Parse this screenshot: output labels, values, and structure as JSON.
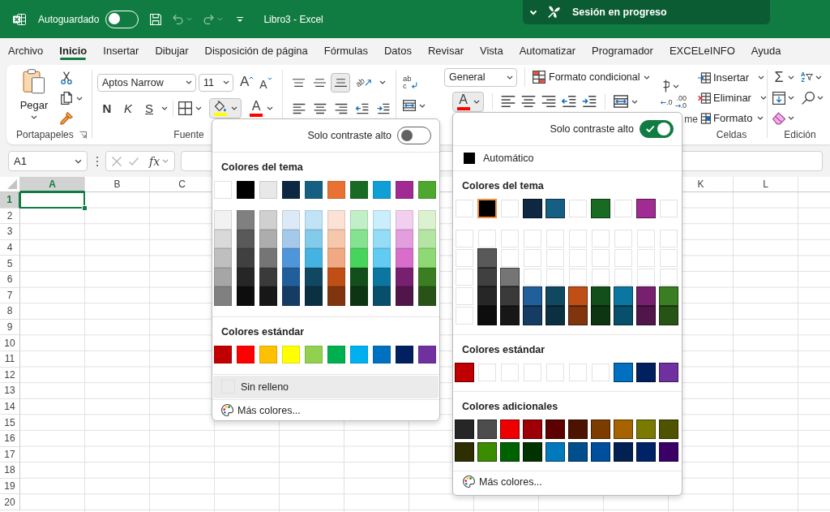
{
  "title_bar": {
    "autosave": {
      "label": "Autoguardado",
      "on": false
    },
    "document_title": "Libro3 - Excel",
    "session": {
      "label": "Sesión en progreso"
    }
  },
  "tabs": [
    {
      "label": "Archivo",
      "selected": false
    },
    {
      "label": "Inicio",
      "selected": true
    },
    {
      "label": "Insertar",
      "selected": false
    },
    {
      "label": "Dibujar",
      "selected": false
    },
    {
      "label": "Disposición de página",
      "selected": false
    },
    {
      "label": "Fórmulas",
      "selected": false
    },
    {
      "label": "Datos",
      "selected": false
    },
    {
      "label": "Revisar",
      "selected": false
    },
    {
      "label": "Vista",
      "selected": false
    },
    {
      "label": "Automatizar",
      "selected": false
    },
    {
      "label": "Programador",
      "selected": false
    },
    {
      "label": "EXCELeINFO",
      "selected": false
    },
    {
      "label": "Ayuda",
      "selected": false
    }
  ],
  "ribbon": {
    "clipboard": {
      "paste_label": "Pegar",
      "group_label": "Portapapeles"
    },
    "font": {
      "font_name": "Aptos Narrow",
      "font_size": "11",
      "grow_font": "A",
      "shrink_font": "A",
      "bold": "N",
      "italic": "K",
      "underline": "S",
      "fill_color": {
        "open": true,
        "color": "#ffff00"
      },
      "font_color": {
        "glyph": "A",
        "open": false,
        "color": "#ff0000"
      },
      "group_label": "Fuente"
    },
    "alignment": {
      "vertical": [
        {
          "selected": false
        },
        {
          "selected": false
        },
        {
          "selected": true
        }
      ],
      "orientation": "ab",
      "wrap_text": [
        "ab",
        "c"
      ]
    },
    "number": {
      "format": "General",
      "decrease_decimal": ".0",
      "increase_decimal": [
        ".00",
        ".0"
      ],
      "group_label": "me"
    },
    "styles": {
      "conditional_formatting": "Formato condicional"
    },
    "font_color_dropdown": {
      "glyph": "A",
      "open": true,
      "color": "#ff0000"
    },
    "cells": {
      "items": [
        "Insertar",
        "Eliminar",
        "Formato"
      ],
      "group_label": "Celdas"
    },
    "editing": {
      "autosum": "Σ",
      "sort_glyphs": [
        "A",
        "Z"
      ],
      "group_label": "Edición"
    }
  },
  "formula_bar": {
    "name_box": "A1",
    "function_label": "fx"
  },
  "grid": {
    "columns_before": [
      {
        "label": "A",
        "selected": true
      },
      {
        "label": "B",
        "selected": false
      },
      {
        "label": "C",
        "selected": false
      }
    ],
    "columns_after": [
      {
        "label": "K",
        "selected": false
      },
      {
        "label": "L",
        "selected": false
      }
    ],
    "rows": [
      {
        "label": "1",
        "selected": true
      },
      {
        "label": "2",
        "selected": false
      },
      {
        "label": "3",
        "selected": false
      },
      {
        "label": "4",
        "selected": false
      },
      {
        "label": "5",
        "selected": false
      },
      {
        "label": "6",
        "selected": false
      },
      {
        "label": "7",
        "selected": false
      },
      {
        "label": "8",
        "selected": false
      },
      {
        "label": "9",
        "selected": false
      },
      {
        "label": "10",
        "selected": false
      },
      {
        "label": "11",
        "selected": false
      },
      {
        "label": "12",
        "selected": false
      },
      {
        "label": "13",
        "selected": false
      },
      {
        "label": "14",
        "selected": false
      },
      {
        "label": "15",
        "selected": false
      },
      {
        "label": "16",
        "selected": false
      },
      {
        "label": "17",
        "selected": false
      },
      {
        "label": "18",
        "selected": false
      },
      {
        "label": "19",
        "selected": false
      },
      {
        "label": "20",
        "selected": false
      }
    ]
  },
  "fill_color_menu": {
    "high_contrast": {
      "label": "Solo contraste alto",
      "on": false
    },
    "sections": [
      {
        "kind": "theme",
        "title": "Colores del tema",
        "top": [
          {
            "kind": "swatch",
            "color": "#ffffff",
            "selected": false
          },
          {
            "kind": "swatch",
            "color": "#000000",
            "selected": false
          },
          {
            "kind": "swatch",
            "color": "#e8e8e8",
            "selected": false
          },
          {
            "kind": "swatch",
            "color": "#0e2841",
            "selected": false
          },
          {
            "kind": "swatch",
            "color": "#156082",
            "selected": false
          },
          {
            "kind": "swatch",
            "color": "#e97132",
            "selected": false
          },
          {
            "kind": "swatch",
            "color": "#196b24",
            "selected": false
          },
          {
            "kind": "swatch",
            "color": "#0f9ed5",
            "selected": false
          },
          {
            "kind": "swatch",
            "color": "#a02b93",
            "selected": false
          },
          {
            "kind": "swatch",
            "color": "#4ea72e",
            "selected": false
          }
        ],
        "shades": [
          [
            {
              "kind": "swatch",
              "color": "#f2f2f2",
              "selected": false
            },
            {
              "kind": "swatch",
              "color": "#808080",
              "selected": false
            },
            {
              "kind": "swatch",
              "color": "#d0d0d0",
              "selected": false
            },
            {
              "kind": "swatch",
              "color": "#dceaf7",
              "selected": false
            },
            {
              "kind": "swatch",
              "color": "#c0e4f5",
              "selected": false
            },
            {
              "kind": "swatch",
              "color": "#fbe2d5",
              "selected": false
            },
            {
              "kind": "swatch",
              "color": "#c1f0c8",
              "selected": false
            },
            {
              "kind": "swatch",
              "color": "#caeefb",
              "selected": false
            },
            {
              "kind": "swatch",
              "color": "#f2ceef",
              "selected": false
            },
            {
              "kind": "swatch",
              "color": "#daf2d0",
              "selected": false
            }
          ],
          [
            {
              "kind": "swatch",
              "color": "#d9d9d9",
              "selected": false
            },
            {
              "kind": "swatch",
              "color": "#595959",
              "selected": false
            },
            {
              "kind": "swatch",
              "color": "#adadad",
              "selected": false
            },
            {
              "kind": "swatch",
              "color": "#a5c9eb",
              "selected": false
            },
            {
              "kind": "swatch",
              "color": "#83cbeb",
              "selected": false
            },
            {
              "kind": "swatch",
              "color": "#f7c7ac",
              "selected": false
            },
            {
              "kind": "swatch",
              "color": "#84e291",
              "selected": false
            },
            {
              "kind": "swatch",
              "color": "#95dcf7",
              "selected": false
            },
            {
              "kind": "swatch",
              "color": "#e59edd",
              "selected": false
            },
            {
              "kind": "swatch",
              "color": "#b4e5a2",
              "selected": false
            }
          ],
          [
            {
              "kind": "swatch",
              "color": "#bfbfbf",
              "selected": false
            },
            {
              "kind": "swatch",
              "color": "#404040",
              "selected": false
            },
            {
              "kind": "swatch",
              "color": "#757575",
              "selected": false
            },
            {
              "kind": "swatch",
              "color": "#4e95d9",
              "selected": false
            },
            {
              "kind": "swatch",
              "color": "#44b3e1",
              "selected": false
            },
            {
              "kind": "swatch",
              "color": "#f1a983",
              "selected": false
            },
            {
              "kind": "swatch",
              "color": "#47d45a",
              "selected": false
            },
            {
              "kind": "swatch",
              "color": "#61cbf3",
              "selected": false
            },
            {
              "kind": "swatch",
              "color": "#d86dcb",
              "selected": false
            },
            {
              "kind": "swatch",
              "color": "#8ed973",
              "selected": false
            }
          ],
          [
            {
              "kind": "swatch",
              "color": "#a6a6a6",
              "selected": false
            },
            {
              "kind": "swatch",
              "color": "#262626",
              "selected": false
            },
            {
              "kind": "swatch",
              "color": "#3a3a3a",
              "selected": false
            },
            {
              "kind": "swatch",
              "color": "#215f9a",
              "selected": false
            },
            {
              "kind": "swatch",
              "color": "#104862",
              "selected": false
            },
            {
              "kind": "swatch",
              "color": "#c04f15",
              "selected": false
            },
            {
              "kind": "swatch",
              "color": "#124f1a",
              "selected": false
            },
            {
              "kind": "swatch",
              "color": "#0b76a0",
              "selected": false
            },
            {
              "kind": "swatch",
              "color": "#782070",
              "selected": false
            },
            {
              "kind": "swatch",
              "color": "#3a7d22",
              "selected": false
            }
          ],
          [
            {
              "kind": "swatch",
              "color": "#808080",
              "selected": false
            },
            {
              "kind": "swatch",
              "color": "#0d0d0d",
              "selected": false
            },
            {
              "kind": "swatch",
              "color": "#171717",
              "selected": false
            },
            {
              "kind": "swatch",
              "color": "#153d64",
              "selected": false
            },
            {
              "kind": "swatch",
              "color": "#0b3041",
              "selected": false
            },
            {
              "kind": "swatch",
              "color": "#80350e",
              "selected": false
            },
            {
              "kind": "swatch",
              "color": "#0d3512",
              "selected": false
            },
            {
              "kind": "swatch",
              "color": "#074f6a",
              "selected": false
            },
            {
              "kind": "swatch",
              "color": "#501549",
              "selected": false
            },
            {
              "kind": "swatch",
              "color": "#275317",
              "selected": false
            }
          ]
        ]
      },
      {
        "kind": "rows",
        "title": "Colores estándar",
        "rows": [
          [
            {
              "kind": "swatch",
              "color": "#c00000",
              "selected": false
            },
            {
              "kind": "swatch",
              "color": "#ff0000",
              "selected": false
            },
            {
              "kind": "swatch",
              "color": "#ffc000",
              "selected": false
            },
            {
              "kind": "swatch",
              "color": "#ffff00",
              "selected": false
            },
            {
              "kind": "swatch",
              "color": "#92d050",
              "selected": false
            },
            {
              "kind": "swatch",
              "color": "#00b050",
              "selected": false
            },
            {
              "kind": "swatch",
              "color": "#00b0f0",
              "selected": false
            },
            {
              "kind": "swatch",
              "color": "#0070c0",
              "selected": false
            },
            {
              "kind": "swatch",
              "color": "#002060",
              "selected": false
            },
            {
              "kind": "swatch",
              "color": "#7030a0",
              "selected": false
            }
          ]
        ]
      }
    ],
    "items": [
      {
        "kind": "none",
        "label": "Sin relleno",
        "highlighted": true
      },
      {
        "kind": "more",
        "label": "Más colores...",
        "highlighted": false
      }
    ]
  },
  "font_color_menu": {
    "high_contrast": {
      "label": "Solo contraste alto",
      "on": true
    },
    "items_top": [
      {
        "kind": "auto",
        "label": "Automático",
        "color": "#000000",
        "highlighted": false
      }
    ],
    "sections": [
      {
        "kind": "theme",
        "title": "Colores del tema",
        "top": [
          {
            "kind": "blank",
            "selected": false
          },
          {
            "kind": "swatch",
            "color": "#000000",
            "selected": true
          },
          {
            "kind": "blank",
            "selected": false
          },
          {
            "kind": "swatch",
            "color": "#0e2841",
            "selected": false
          },
          {
            "kind": "swatch",
            "color": "#156082",
            "selected": false
          },
          {
            "kind": "blank",
            "selected": false
          },
          {
            "kind": "swatch",
            "color": "#196b24",
            "selected": false
          },
          {
            "kind": "blank",
            "selected": false
          },
          {
            "kind": "swatch",
            "color": "#a02b93",
            "selected": false
          },
          {
            "kind": "blank",
            "selected": false
          }
        ],
        "shades": [
          [
            {
              "kind": "blank",
              "selected": false
            },
            {
              "kind": "blank",
              "selected": false
            },
            {
              "kind": "blank",
              "selected": false
            },
            {
              "kind": "blank",
              "selected": false
            },
            {
              "kind": "blank",
              "selected": false
            },
            {
              "kind": "blank",
              "selected": false
            },
            {
              "kind": "blank",
              "selected": false
            },
            {
              "kind": "blank",
              "selected": false
            },
            {
              "kind": "blank",
              "selected": false
            },
            {
              "kind": "blank",
              "selected": false
            }
          ],
          [
            {
              "kind": "blank",
              "selected": false
            },
            {
              "kind": "swatch",
              "color": "#595959",
              "selected": false
            },
            {
              "kind": "blank",
              "selected": false
            },
            {
              "kind": "blank",
              "selected": false
            },
            {
              "kind": "blank",
              "selected": false
            },
            {
              "kind": "blank",
              "selected": false
            },
            {
              "kind": "blank",
              "selected": false
            },
            {
              "kind": "blank",
              "selected": false
            },
            {
              "kind": "blank",
              "selected": false
            },
            {
              "kind": "blank",
              "selected": false
            }
          ],
          [
            {
              "kind": "blank",
              "selected": false
            },
            {
              "kind": "swatch",
              "color": "#404040",
              "selected": false
            },
            {
              "kind": "swatch",
              "color": "#757575",
              "selected": false
            },
            {
              "kind": "blank",
              "selected": false
            },
            {
              "kind": "blank",
              "selected": false
            },
            {
              "kind": "blank",
              "selected": false
            },
            {
              "kind": "blank",
              "selected": false
            },
            {
              "kind": "blank",
              "selected": false
            },
            {
              "kind": "blank",
              "selected": false
            },
            {
              "kind": "blank",
              "selected": false
            }
          ],
          [
            {
              "kind": "blank",
              "selected": false
            },
            {
              "kind": "swatch",
              "color": "#262626",
              "selected": false
            },
            {
              "kind": "swatch",
              "color": "#3a3a3a",
              "selected": false
            },
            {
              "kind": "swatch",
              "color": "#215f9a",
              "selected": false
            },
            {
              "kind": "swatch",
              "color": "#104862",
              "selected": false
            },
            {
              "kind": "swatch",
              "color": "#c04f15",
              "selected": false
            },
            {
              "kind": "swatch",
              "color": "#124f1a",
              "selected": false
            },
            {
              "kind": "swatch",
              "color": "#0b76a0",
              "selected": false
            },
            {
              "kind": "swatch",
              "color": "#782070",
              "selected": false
            },
            {
              "kind": "swatch",
              "color": "#3a7d22",
              "selected": false
            }
          ],
          [
            {
              "kind": "blank",
              "selected": false
            },
            {
              "kind": "swatch",
              "color": "#0d0d0d",
              "selected": false
            },
            {
              "kind": "swatch",
              "color": "#171717",
              "selected": false
            },
            {
              "kind": "swatch",
              "color": "#153d64",
              "selected": false
            },
            {
              "kind": "swatch",
              "color": "#0b3041",
              "selected": false
            },
            {
              "kind": "swatch",
              "color": "#80350e",
              "selected": false
            },
            {
              "kind": "swatch",
              "color": "#0d3512",
              "selected": false
            },
            {
              "kind": "swatch",
              "color": "#074f6a",
              "selected": false
            },
            {
              "kind": "swatch",
              "color": "#501549",
              "selected": false
            },
            {
              "kind": "swatch",
              "color": "#275317",
              "selected": false
            }
          ]
        ]
      },
      {
        "kind": "rows",
        "title": "Colores estándar",
        "rows": [
          [
            {
              "kind": "swatch",
              "color": "#c00000",
              "selected": false
            },
            {
              "kind": "blank",
              "selected": false
            },
            {
              "kind": "blank",
              "selected": false
            },
            {
              "kind": "blank",
              "selected": false
            },
            {
              "kind": "blank",
              "selected": false
            },
            {
              "kind": "blank",
              "selected": false
            },
            {
              "kind": "blank",
              "selected": false
            },
            {
              "kind": "swatch",
              "color": "#0070c0",
              "selected": false
            },
            {
              "kind": "swatch",
              "color": "#002060",
              "selected": false
            },
            {
              "kind": "swatch",
              "color": "#7030a0",
              "selected": false
            }
          ]
        ]
      },
      {
        "kind": "rows",
        "title": "Colores adicionales",
        "rows": [
          [
            {
              "kind": "swatch",
              "color": "#262626",
              "selected": false
            },
            {
              "kind": "swatch",
              "color": "#4d4d4d",
              "selected": false
            },
            {
              "kind": "swatch",
              "color": "#ee0000",
              "selected": false
            },
            {
              "kind": "swatch",
              "color": "#9c0006",
              "selected": false
            },
            {
              "kind": "swatch",
              "color": "#5c0000",
              "selected": false
            },
            {
              "kind": "swatch",
              "color": "#4d1300",
              "selected": false
            },
            {
              "kind": "swatch",
              "color": "#7c3c00",
              "selected": false
            },
            {
              "kind": "swatch",
              "color": "#a66300",
              "selected": false
            },
            {
              "kind": "swatch",
              "color": "#7a7a00",
              "selected": false
            },
            {
              "kind": "swatch",
              "color": "#4f5300",
              "selected": false
            }
          ],
          [
            {
              "kind": "swatch",
              "color": "#2e2e00",
              "selected": false
            },
            {
              "kind": "swatch",
              "color": "#3b8c00",
              "selected": false
            },
            {
              "kind": "swatch",
              "color": "#006100",
              "selected": false
            },
            {
              "kind": "swatch",
              "color": "#003300",
              "selected": false
            },
            {
              "kind": "swatch",
              "color": "#007abd",
              "selected": false
            },
            {
              "kind": "swatch",
              "color": "#004f8c",
              "selected": false
            },
            {
              "kind": "swatch",
              "color": "#004f9e",
              "selected": false
            },
            {
              "kind": "swatch",
              "color": "#002152",
              "selected": false
            },
            {
              "kind": "swatch",
              "color": "#002266",
              "selected": false
            },
            {
              "kind": "swatch",
              "color": "#3b0066",
              "selected": false
            }
          ]
        ]
      }
    ],
    "items": [
      {
        "kind": "more",
        "label": "Más colores...",
        "highlighted": false
      }
    ]
  }
}
